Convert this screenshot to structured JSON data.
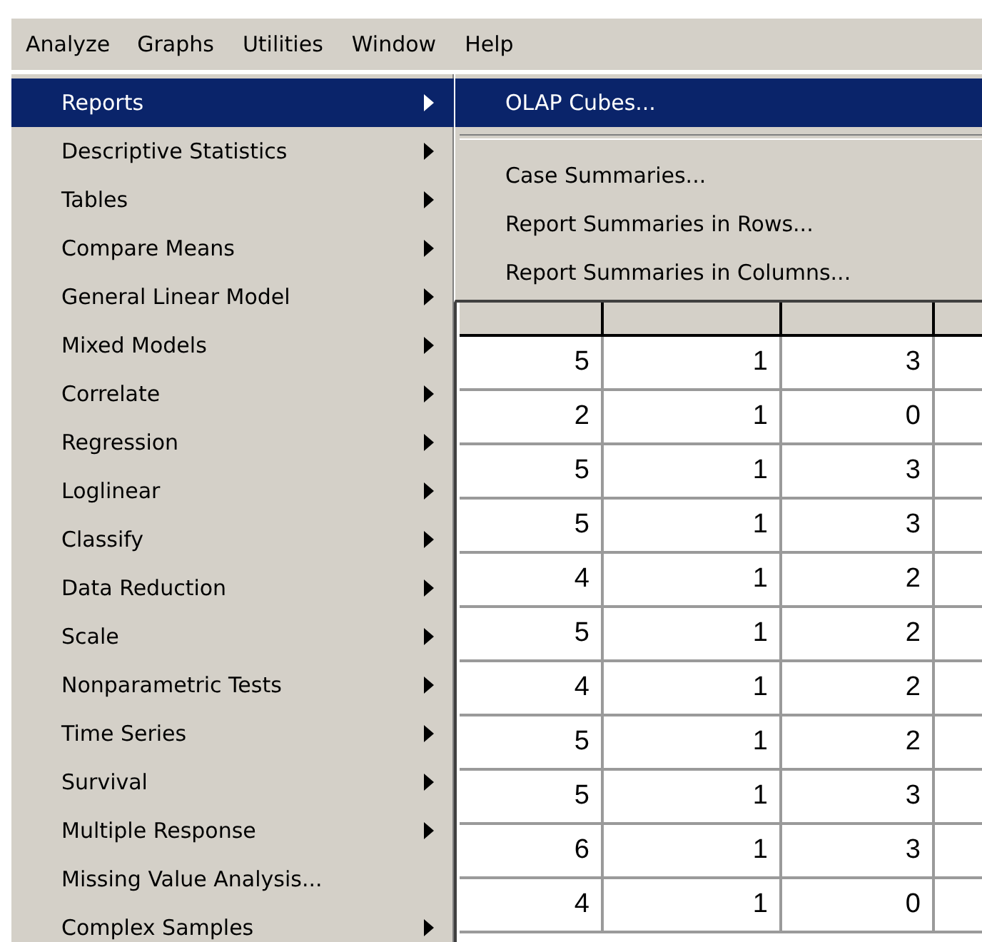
{
  "menubar": [
    {
      "label": "Analyze",
      "selected": true
    },
    {
      "label": "Graphs",
      "selected": false
    },
    {
      "label": "Utilities",
      "selected": false
    },
    {
      "label": "Window",
      "selected": false
    },
    {
      "label": "Help",
      "selected": false
    }
  ],
  "menu": {
    "items": [
      {
        "label": "Reports",
        "submenu": true,
        "selected": true
      },
      {
        "label": "Descriptive Statistics",
        "submenu": true,
        "selected": false
      },
      {
        "label": "Tables",
        "submenu": true,
        "selected": false
      },
      {
        "label": "Compare Means",
        "submenu": true,
        "selected": false
      },
      {
        "label": "General Linear Model",
        "submenu": true,
        "selected": false
      },
      {
        "label": "Mixed Models",
        "submenu": true,
        "selected": false
      },
      {
        "label": "Correlate",
        "submenu": true,
        "selected": false
      },
      {
        "label": "Regression",
        "submenu": true,
        "selected": false
      },
      {
        "label": "Loglinear",
        "submenu": true,
        "selected": false
      },
      {
        "label": "Classify",
        "submenu": true,
        "selected": false
      },
      {
        "label": "Data Reduction",
        "submenu": true,
        "selected": false
      },
      {
        "label": "Scale",
        "submenu": true,
        "selected": false
      },
      {
        "label": "Nonparametric Tests",
        "submenu": true,
        "selected": false
      },
      {
        "label": "Time Series",
        "submenu": true,
        "selected": false
      },
      {
        "label": "Survival",
        "submenu": true,
        "selected": false
      },
      {
        "label": "Multiple Response",
        "submenu": true,
        "selected": false
      },
      {
        "label": "Missing Value Analysis...",
        "submenu": false,
        "selected": false
      },
      {
        "label": "Complex Samples",
        "submenu": true,
        "selected": false
      }
    ]
  },
  "submenu": {
    "items": [
      {
        "kind": "item",
        "label": "OLAP Cubes...",
        "selected": true
      },
      {
        "kind": "separator"
      },
      {
        "kind": "item",
        "label": "Case Summaries...",
        "selected": false
      },
      {
        "kind": "item",
        "label": "Report Summaries in Rows...",
        "selected": false
      },
      {
        "kind": "item",
        "label": "Report Summaries in Columns...",
        "selected": false
      }
    ]
  },
  "grid": {
    "rows": [
      [
        "5",
        "1",
        "3"
      ],
      [
        "2",
        "1",
        "0"
      ],
      [
        "5",
        "1",
        "3"
      ],
      [
        "5",
        "1",
        "3"
      ],
      [
        "4",
        "1",
        "2"
      ],
      [
        "5",
        "1",
        "2"
      ],
      [
        "4",
        "1",
        "2"
      ],
      [
        "5",
        "1",
        "2"
      ],
      [
        "5",
        "1",
        "3"
      ],
      [
        "6",
        "1",
        "3"
      ],
      [
        "4",
        "1",
        "0"
      ]
    ]
  }
}
